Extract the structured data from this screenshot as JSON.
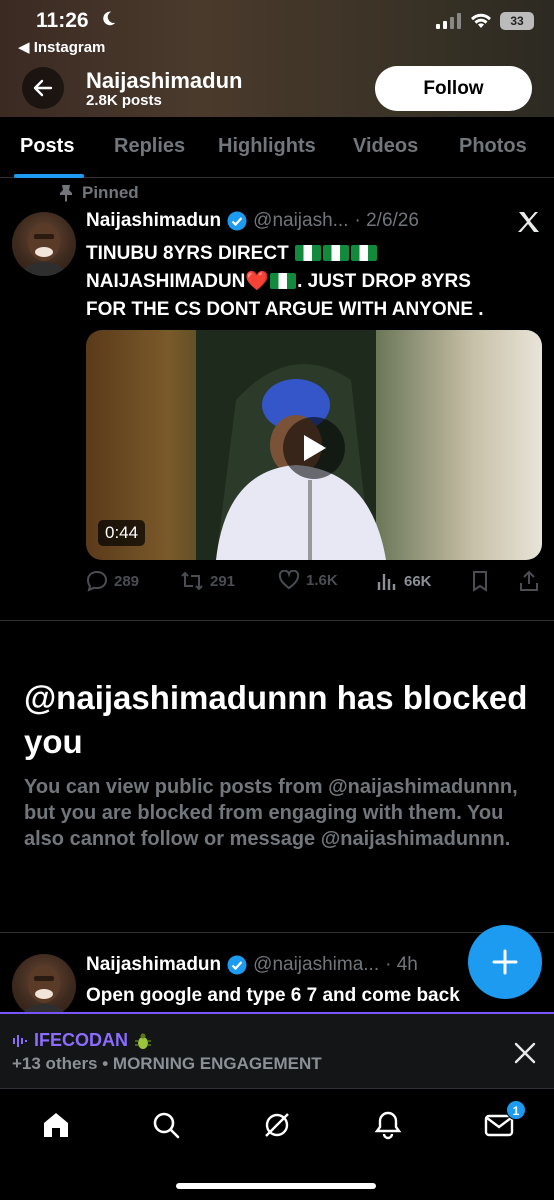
{
  "status_bar": {
    "time": "11:26",
    "back_app": "◀ Instagram",
    "battery": "33"
  },
  "header": {
    "name": "Naijashimadun",
    "post_count": "2.8K posts",
    "follow_label": "Follow"
  },
  "tabs": [
    "Posts",
    "Replies",
    "Highlights",
    "Videos",
    "Photos"
  ],
  "pinned_tweet": {
    "pinned_label": "Pinned",
    "name": "Naijashimadun",
    "handle": "@naijash...",
    "date": "· 2/6/26",
    "text_line1": "TINUBU 8YRS DIRECT",
    "text_line2": "NAIJASHIMADUN",
    "text_line2b": ". JUST DROP 8YRS",
    "text_line3": "FOR THE CS DONT ARGUE WITH ANYONE .",
    "video_duration": "0:44",
    "replies": "289",
    "reposts": "291",
    "likes": "1.6K",
    "views": "66K"
  },
  "blocked": {
    "title": "@naijashimadunnn has blocked you",
    "description": "You can view public posts from @naijashimadunnn, but you are blocked from engaging with them. You also cannot follow or message @naijashimadunnn."
  },
  "second_tweet": {
    "name": "Naijashimadun",
    "handle": "@naijashima...",
    "time": "· 4h",
    "text": "Open google and type 6 7 and come back"
  },
  "banner": {
    "title": "IFECODAN",
    "subtitle": "+13 others • MORNING ENGAGEMENT"
  },
  "bottom_nav": {
    "messages_badge": "1"
  },
  "colors": {
    "accent": "#1d9bf0",
    "spaces_purple": "#7856ff",
    "background": "#000000"
  }
}
